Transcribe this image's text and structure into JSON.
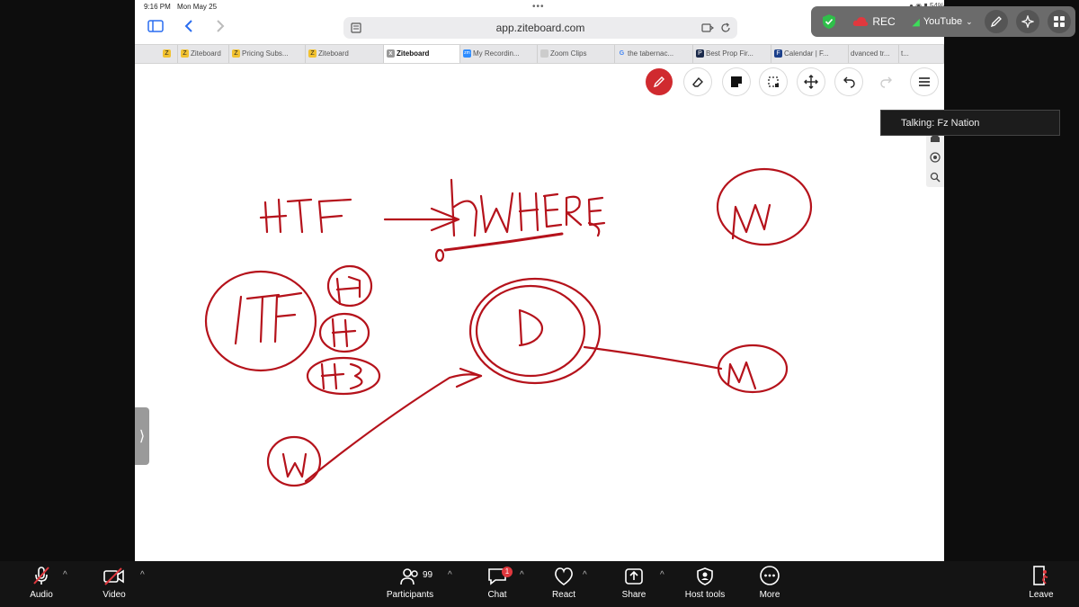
{
  "status_bar": {
    "time": "9:16 PM",
    "date": "Mon May 25",
    "battery": "54%"
  },
  "browser": {
    "url": "app.ziteboard.com",
    "tabs": [
      {
        "label": "",
        "favicon": "Z",
        "color": "#f2c230"
      },
      {
        "label": "Ziteboard",
        "favicon": "Z",
        "color": "#f2c230"
      },
      {
        "label": "Pricing Subs...",
        "favicon": "Z",
        "color": "#f2c230"
      },
      {
        "label": "Ziteboard",
        "favicon": "Z",
        "color": "#f2c230"
      },
      {
        "label": "Ziteboard",
        "favicon": "x",
        "color": "#888888",
        "active": true
      },
      {
        "label": "My Recordin...",
        "favicon": "zm",
        "color": "#2d8cff"
      },
      {
        "label": "Zoom Clips",
        "favicon": "",
        "color": "#cccccc"
      },
      {
        "label": "the tabernac...",
        "favicon": "G",
        "color": "#4285f4"
      },
      {
        "label": "Best Prop Fir...",
        "favicon": "P",
        "color": "#1b2a4a"
      },
      {
        "label": "Calendar | F...",
        "favicon": "F",
        "color": "#1b3f8a"
      },
      {
        "label": "dvanced tr...",
        "favicon": "",
        "color": "#dddddd"
      },
      {
        "label": "t...",
        "favicon": "",
        "color": "#dddddd"
      }
    ]
  },
  "whiteboard": {
    "tools": [
      "pen-tool",
      "eraser-tool",
      "sticky-note-tool",
      "select-tool",
      "move-tool",
      "undo",
      "redo",
      "menu"
    ],
    "accent_color": "#d02a2f",
    "ink_color": "#b5121b"
  },
  "zoom_overlay": {
    "rec_label": "REC",
    "youtube_label": "YouTube",
    "talking": "Talking: Fz Nation"
  },
  "zoom_bar": {
    "audio": "Audio",
    "video": "Video",
    "participants": "Participants",
    "participants_count": "99",
    "chat": "Chat",
    "chat_badge": "1",
    "react": "React",
    "share": "Share",
    "host_tools": "Host tools",
    "more": "More",
    "leave": "Leave"
  }
}
